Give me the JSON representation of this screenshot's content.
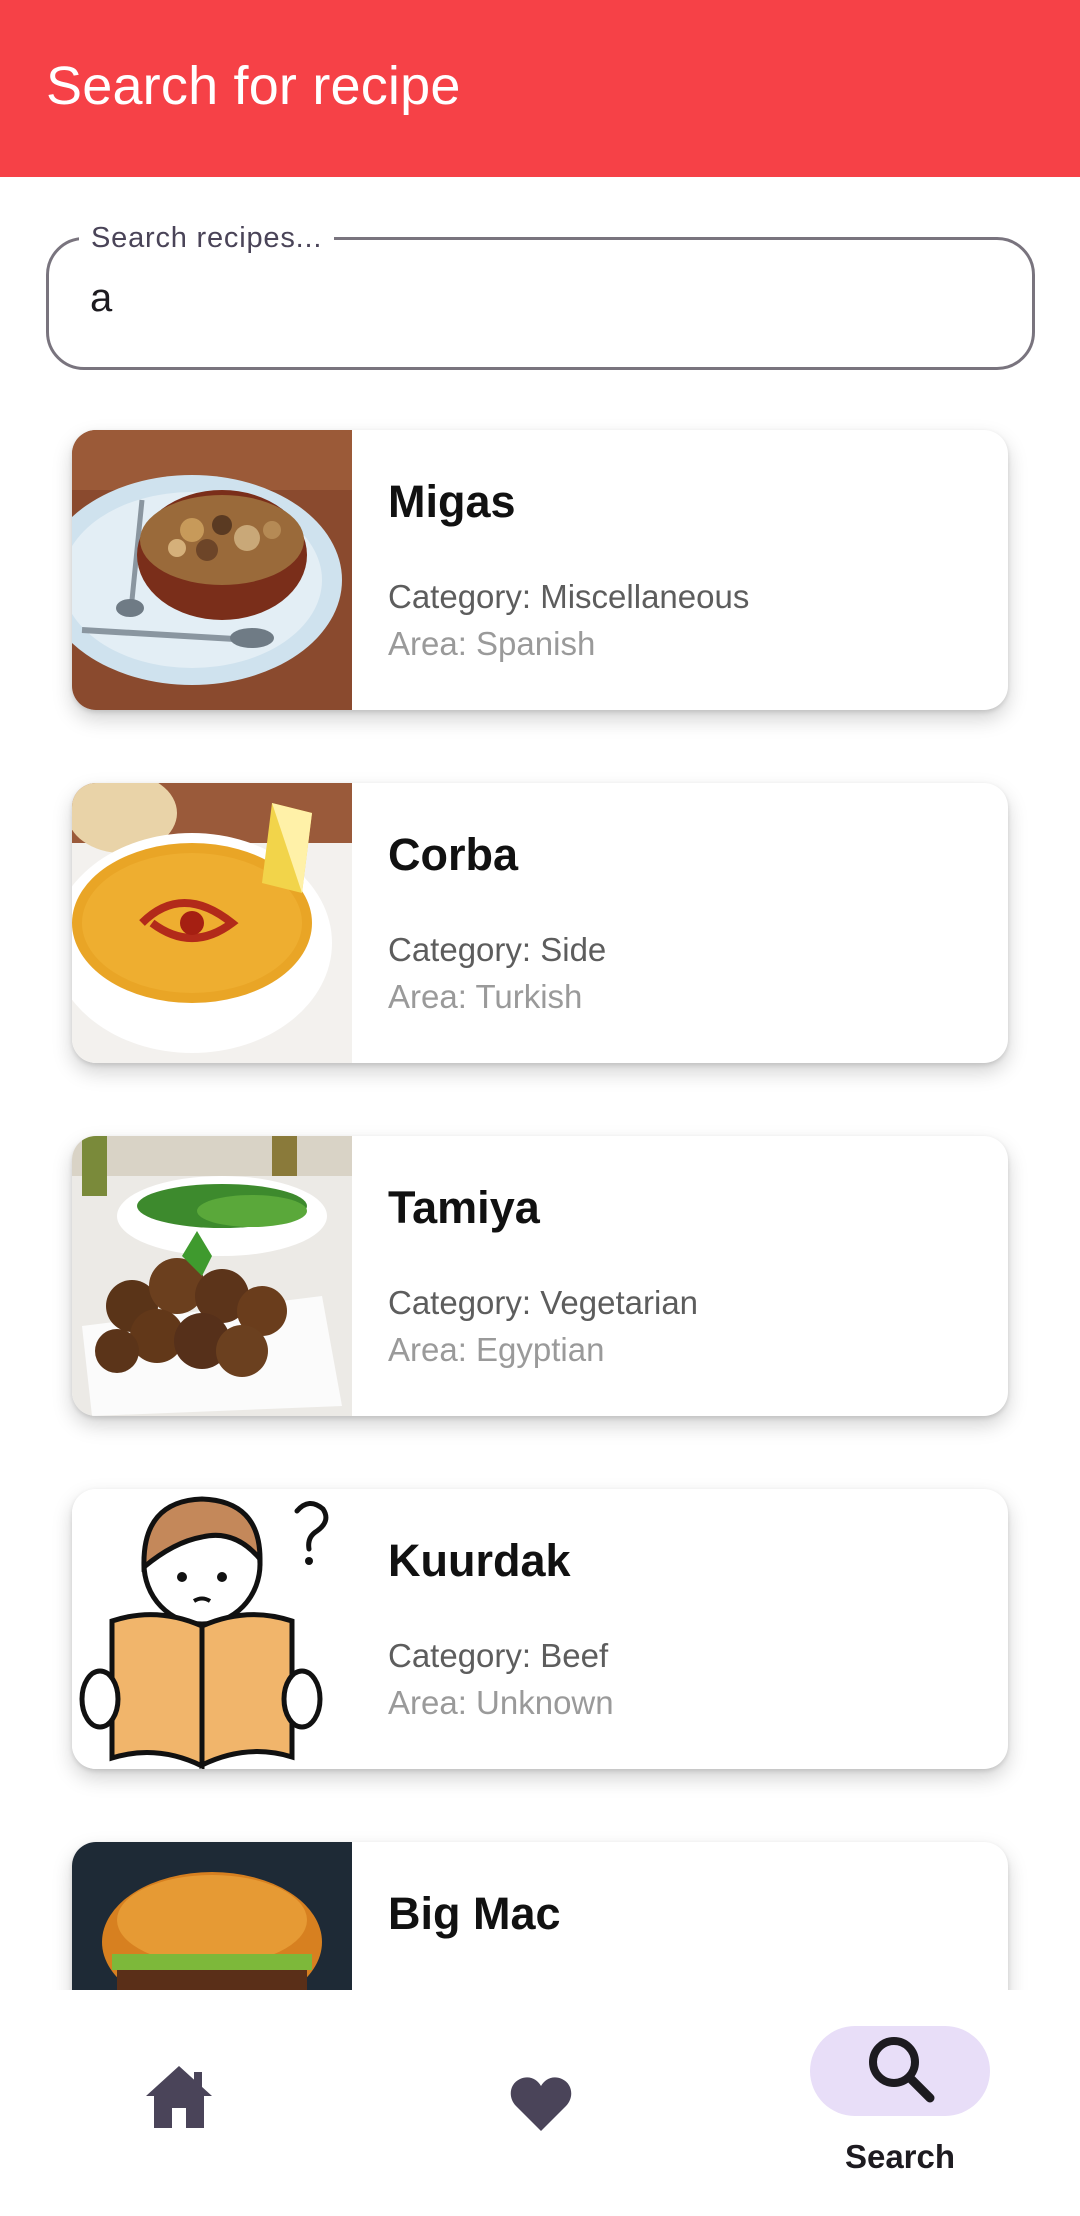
{
  "topbar": {
    "title": "Search for recipe"
  },
  "search": {
    "label": "Search recipes...",
    "value": "a"
  },
  "recipes": [
    {
      "name": "Migas",
      "category": "Category: Miscellaneous",
      "area": "Area: Spanish"
    },
    {
      "name": "Corba",
      "category": "Category: Side",
      "area": "Area: Turkish"
    },
    {
      "name": "Tamiya",
      "category": "Category: Vegetarian",
      "area": "Area: Egyptian"
    },
    {
      "name": "Kuurdak",
      "category": "Category: Beef",
      "area": "Area: Unknown"
    },
    {
      "name": "Big Mac",
      "category": "",
      "area": ""
    }
  ],
  "bottom_nav": {
    "items": [
      {
        "icon": "home-icon",
        "label": ""
      },
      {
        "icon": "heart-icon",
        "label": ""
      },
      {
        "icon": "search-icon",
        "label": "Search",
        "selected": true
      }
    ]
  },
  "colors": {
    "topbar": "#f64147",
    "nav_indicator": "#e8def8"
  }
}
